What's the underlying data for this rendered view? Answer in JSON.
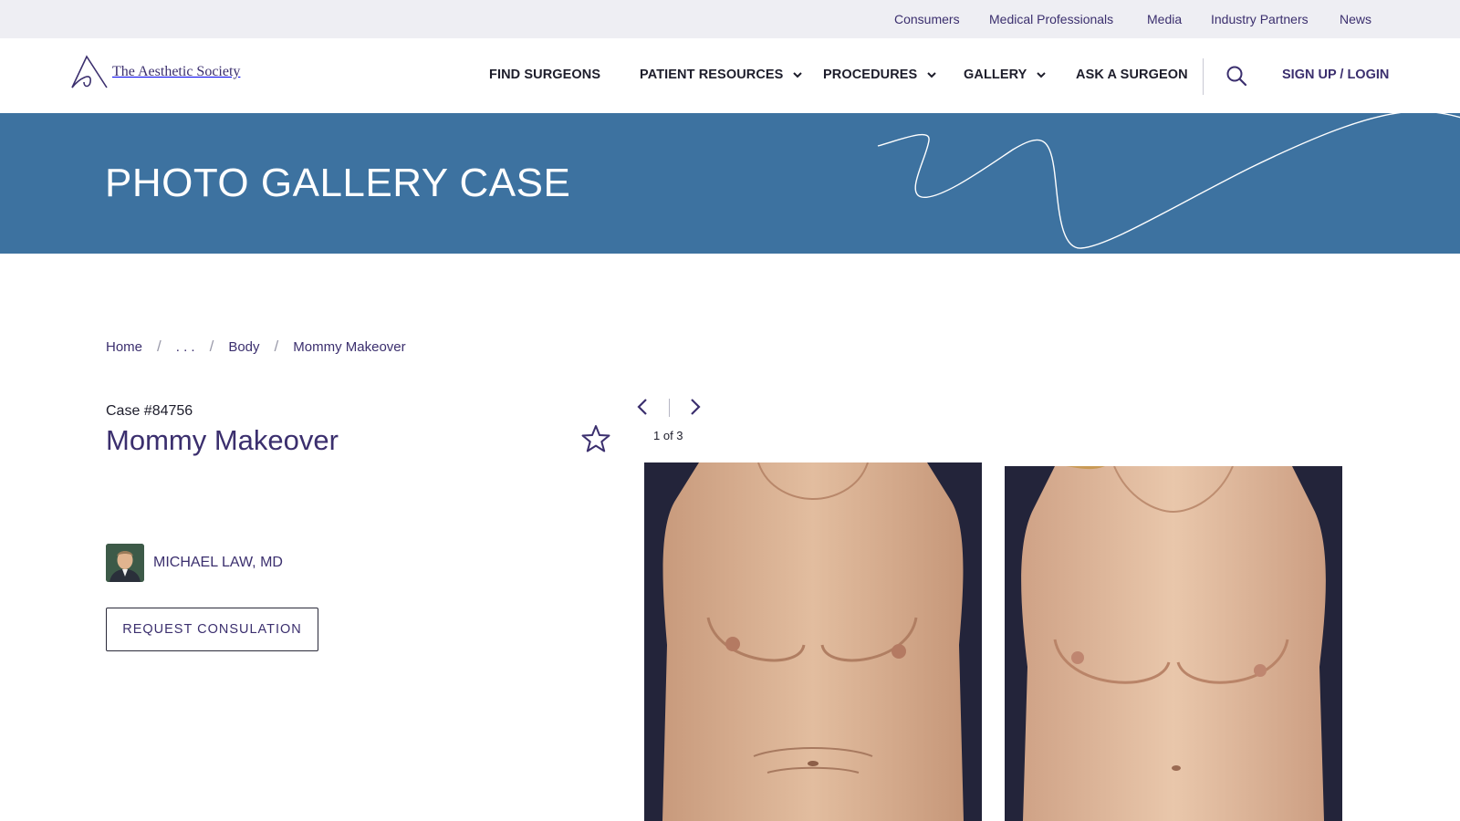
{
  "utility_nav": [
    "Consumers",
    "Medical Professionals",
    "Media",
    "Industry Partners",
    "News"
  ],
  "logo": {
    "text": "The Aesthetic Society"
  },
  "main_nav": {
    "items": [
      {
        "label": "FIND SURGEONS",
        "has_dropdown": false
      },
      {
        "label": "PATIENT RESOURCES",
        "has_dropdown": true
      },
      {
        "label": "PROCEDURES",
        "has_dropdown": true
      },
      {
        "label": "GALLERY",
        "has_dropdown": true
      },
      {
        "label": "ASK A SURGEON",
        "has_dropdown": false
      }
    ],
    "search_icon": "search-icon",
    "login_label": "SIGN UP / LOGIN"
  },
  "hero": {
    "title": "PHOTO GALLERY CASE"
  },
  "breadcrumb": [
    "Home",
    ". . .",
    "Body",
    "Mommy Makeover"
  ],
  "case": {
    "number": "Case #84756",
    "title": "Mommy Makeover",
    "favorite_icon": "star-outline-icon"
  },
  "surgeon": {
    "name": "MICHAEL LAW, MD"
  },
  "consult_button": "REQUEST CONSULATION",
  "pager": {
    "current": 1,
    "total": 3,
    "label": "1 of 3"
  },
  "photos": [
    {
      "name": "before-photo"
    },
    {
      "name": "after-photo"
    }
  ],
  "colors": {
    "brand_purple": "#3b2f6e",
    "hero_blue": "#3d72a0",
    "utility_bg": "#eeeef3"
  }
}
